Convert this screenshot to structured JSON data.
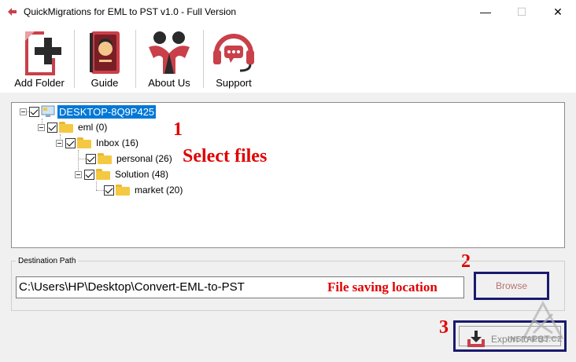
{
  "window": {
    "title": "QuickMigrations for EML to PST v1.0 - Full Version",
    "minimize_glyph": "—",
    "maximize_glyph": "☐",
    "close_glyph": "✕"
  },
  "toolbar": {
    "items": [
      {
        "label": "Add Folder",
        "icon": "add-folder-icon"
      },
      {
        "label": "Guide",
        "icon": "guide-book-icon"
      },
      {
        "label": "About Us",
        "icon": "people-icon"
      },
      {
        "label": "Support",
        "icon": "headset-icon"
      }
    ]
  },
  "tree": {
    "root": "DESKTOP-8Q9P425",
    "nodes": [
      {
        "label": "eml (0)"
      },
      {
        "label": "Inbox (16)"
      },
      {
        "label": "personal (26)"
      },
      {
        "label": "Solution (48)"
      },
      {
        "label": "market (20)"
      }
    ]
  },
  "annotations": {
    "step1": "1",
    "step1_text": "Select files",
    "step2": "2",
    "step3": "3",
    "path_text": "File saving location"
  },
  "destination": {
    "legend": "Destination Path",
    "path_value": "C:\\Users\\HP\\Desktop\\Convert-EML-to-PST",
    "browse_label": "Browse"
  },
  "export": {
    "label": "Export to PST"
  },
  "watermark": {
    "text": "INSTALUJ.CZ"
  },
  "colors": {
    "accent_red": "#c9404a",
    "selection_blue": "#0078d7",
    "annotation_red": "#e00000",
    "highlight_navy": "#1a1a6e"
  }
}
